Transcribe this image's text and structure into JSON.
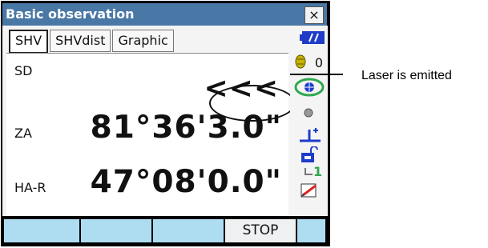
{
  "window": {
    "title": "Basic observation",
    "close_label": "×"
  },
  "tabs": [
    {
      "label": "SHV",
      "active": true
    },
    {
      "label": "SHVdist",
      "active": false
    },
    {
      "label": "Graphic",
      "active": false
    }
  ],
  "measurements": {
    "sd": {
      "label": "SD",
      "value": "<<<"
    },
    "za": {
      "label": "ZA",
      "value": "81°36'3.0\""
    },
    "ha": {
      "label": "HA-R",
      "value": "47°08'0.0\""
    }
  },
  "sidebar": {
    "coin_count": "0",
    "page_number": "1"
  },
  "softkeys": [
    "",
    "",
    "",
    "STOP",
    ""
  ],
  "annotation": {
    "text": "Laser is emitted"
  },
  "colors": {
    "titlebar": "#4a78a6",
    "softkey": "#aedcf0",
    "battery": "#1e3cc8",
    "target_green": "#2fa84f"
  }
}
